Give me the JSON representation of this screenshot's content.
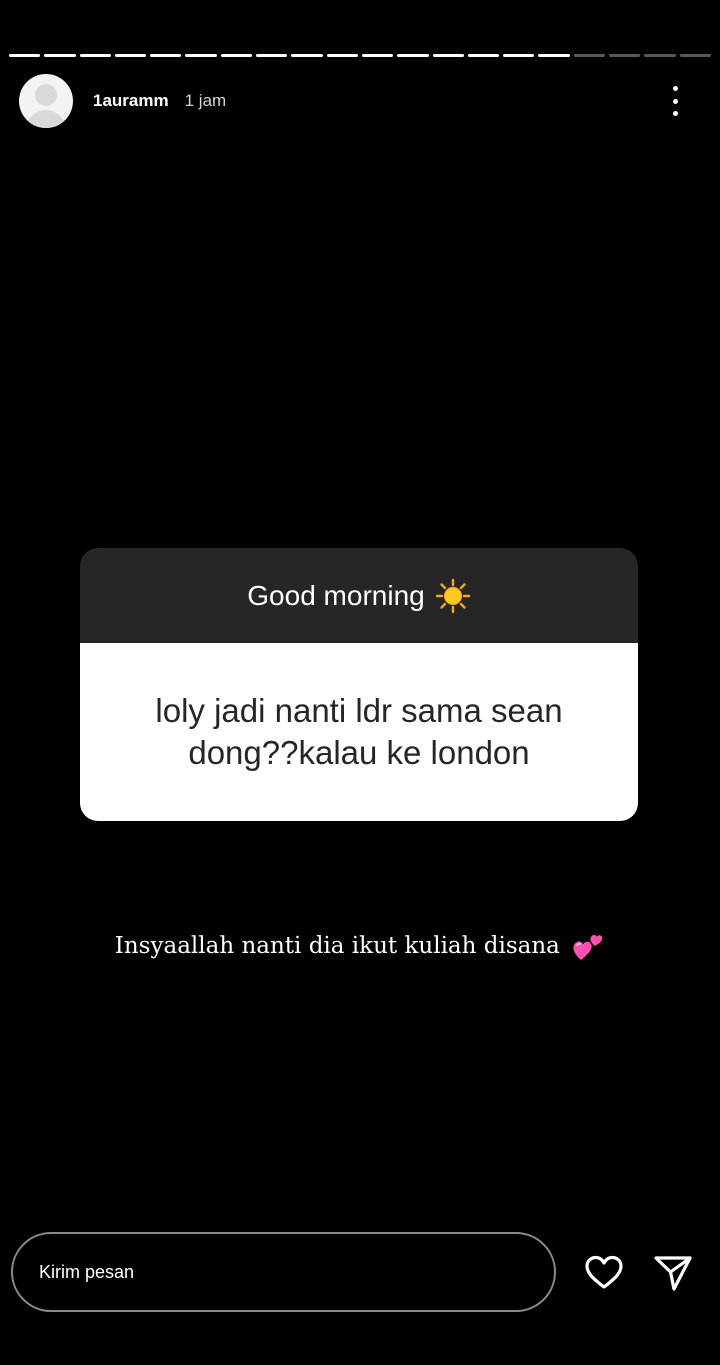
{
  "story": {
    "progress_segments": 20,
    "progress_completed": 16
  },
  "header": {
    "username": "1auramm",
    "time": "1 jam",
    "avatar_icon": "default-avatar-icon",
    "more_icon": "vertical-ellipsis-icon"
  },
  "question_sticker": {
    "prompt": "Good morning",
    "prompt_emoji": "sun-icon",
    "question": "loly jadi nanti ldr sama sean dong??kalau ke london"
  },
  "answer": {
    "text": "Insyaallah nanti dia ikut kuliah disana",
    "emoji": "two-hearts-icon"
  },
  "footer": {
    "message_placeholder": "Kirim pesan",
    "like_icon": "heart-icon",
    "send_icon": "send-icon"
  },
  "colors": {
    "background": "#000000",
    "sticker_header": "#262626",
    "sticker_body": "#ffffff",
    "heart_emoji": "#ff4fb0"
  }
}
